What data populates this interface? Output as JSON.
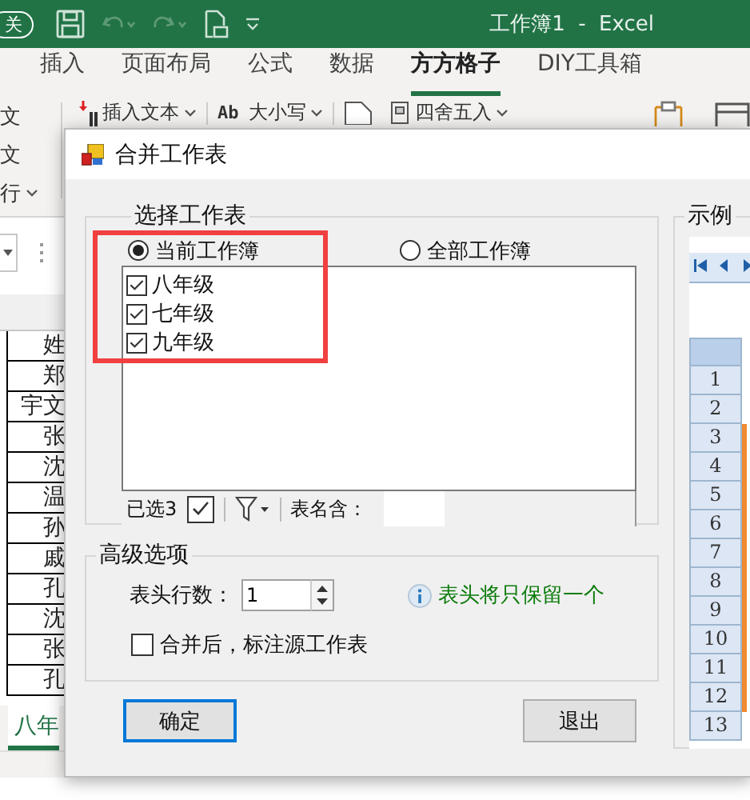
{
  "title_bar": {
    "autosave": "关",
    "title": "工作簿1  -  Excel"
  },
  "ribbon_tabs": [
    {
      "label": "插入",
      "selected": false
    },
    {
      "label": "页面布局",
      "selected": false
    },
    {
      "label": "公式",
      "selected": false
    },
    {
      "label": "数据",
      "selected": false
    },
    {
      "label": "方方格子",
      "selected": true
    },
    {
      "label": "DIY工具箱",
      "selected": false
    }
  ],
  "ribbon_left": [
    "文",
    "文",
    "行"
  ],
  "ribbon_commands": [
    {
      "kind": "insert",
      "label": "插入文本"
    },
    {
      "kind": "case",
      "prefix": "Ab",
      "label": "大小写"
    },
    {
      "kind": "round",
      "label": "四舍五入"
    }
  ],
  "sheet": {
    "cells": [
      "姓",
      "郑",
      "宇文",
      "张",
      "沈",
      "温",
      "孙",
      "戚",
      "孔",
      "沈",
      "张",
      "孔"
    ],
    "tabs": [
      {
        "label": "八年",
        "selected": true
      }
    ]
  },
  "dialog": {
    "title": "合并工作表",
    "select_group": {
      "title": "选择工作表",
      "scopes": [
        {
          "label": "当前工作簿",
          "selected": true
        },
        {
          "label": "全部工作簿",
          "selected": false
        }
      ],
      "sheets": [
        {
          "label": "八年级",
          "checked": true
        },
        {
          "label": "七年级",
          "checked": true
        },
        {
          "label": "九年级",
          "checked": true
        }
      ],
      "selected_count": "已选3",
      "name_filter_label": "表名含："
    },
    "advanced": {
      "title": "高级选项",
      "header_rows_label": "表头行数：",
      "header_rows": "1",
      "info": "表头将只保留一个",
      "mark_source": {
        "label": "合并后，标注源工作表",
        "checked": false
      }
    },
    "buttons": [
      {
        "label": "确定",
        "focused": true
      },
      {
        "label": "退出",
        "focused": false
      }
    ],
    "example": {
      "title": "示例",
      "row_numbers": [
        "1",
        "2",
        "3",
        "4",
        "5",
        "6",
        "7",
        "8",
        "9",
        "10",
        "11",
        "12",
        "13"
      ]
    }
  }
}
